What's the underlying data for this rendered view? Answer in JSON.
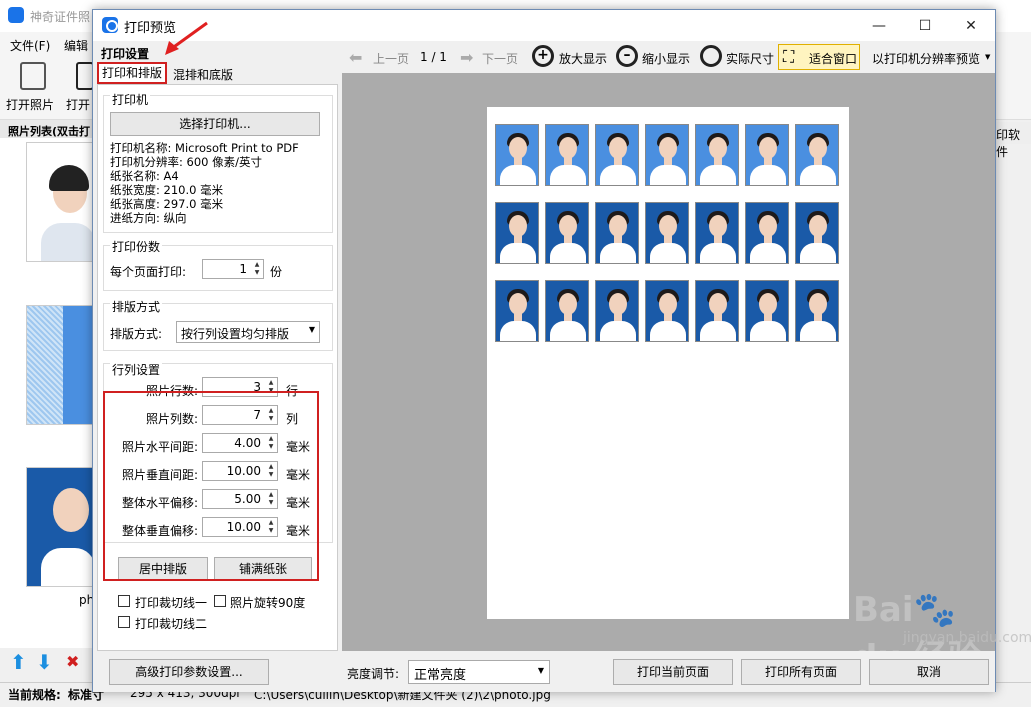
{
  "bg": {
    "title": "神奇证件照",
    "menu": [
      "文件(F)",
      "编辑"
    ],
    "toolbar": [
      "打开照片",
      "打开"
    ],
    "list_header": "照片列表(双击打",
    "right_label": "印软件",
    "status_prefix": "当前规格:",
    "status_spec": "标准寸",
    "status_size": "295 x 413, 300dpi",
    "status_path": "C:\\Users\\cuilin\\Desktop\\新建文件夹 (2)\\2\\photo.jpg",
    "photo_caption": "ph"
  },
  "dialog": {
    "title": "打印预览",
    "min": "—",
    "max": "☐",
    "close": "✕"
  },
  "settings": {
    "title": "打印设置",
    "tabs": [
      "打印和排版",
      "混排和底版"
    ],
    "printer": {
      "group": "打印机",
      "select_btn": "选择打印机...",
      "lines": [
        "打印机名称: Microsoft Print to PDF",
        "打印机分辨率: 600 像素/英寸",
        "纸张名称: A4",
        "纸张宽度: 210.0 毫米",
        "纸张高度: 297.0 毫米",
        "进纸方向: 纵向"
      ]
    },
    "copies": {
      "group": "打印份数",
      "label": "每个页面打印:",
      "value": "1",
      "unit": "份"
    },
    "layout": {
      "group": "排版方式",
      "label": "排版方式:",
      "value": "按行列设置均匀排版"
    },
    "rowcol": {
      "group": "行列设置",
      "fields": [
        {
          "label": "照片行数:",
          "value": "3",
          "unit": "行"
        },
        {
          "label": "照片列数:",
          "value": "7",
          "unit": "列"
        },
        {
          "label": "照片水平间距:",
          "value": "4.00",
          "unit": "毫米"
        },
        {
          "label": "照片垂直间距:",
          "value": "10.00",
          "unit": "毫米"
        },
        {
          "label": "整体水平偏移:",
          "value": "5.00",
          "unit": "毫米"
        },
        {
          "label": "整体垂直偏移:",
          "value": "10.00",
          "unit": "毫米"
        }
      ]
    },
    "center_btn": "居中排版",
    "fill_btn": "铺满纸张",
    "checks": [
      "打印裁切线一",
      "照片旋转90度",
      "打印裁切线二"
    ]
  },
  "toolbar": {
    "prev": "上一页",
    "page": "1 / 1",
    "next": "下一页",
    "zoom_in": "放大显示",
    "zoom_out": "缩小显示",
    "actual": "实际尺寸",
    "fit": "适合窗口",
    "preview_mode": "以打印机分辨率预览"
  },
  "bottom": {
    "advanced": "高级打印参数设置...",
    "brightness_label": "亮度调节:",
    "brightness_value": "正常亮度",
    "print_current": "打印当前页面",
    "print_all": "打印所有页面",
    "cancel": "取消"
  },
  "watermark": {
    "text": "Bai du 经验",
    "url": "jingyan.baidu.com"
  },
  "colors": {
    "blue_bg": "#4a8fe0",
    "dark_blue_bg": "#1a5aa8",
    "red_highlight": "#d02020"
  }
}
